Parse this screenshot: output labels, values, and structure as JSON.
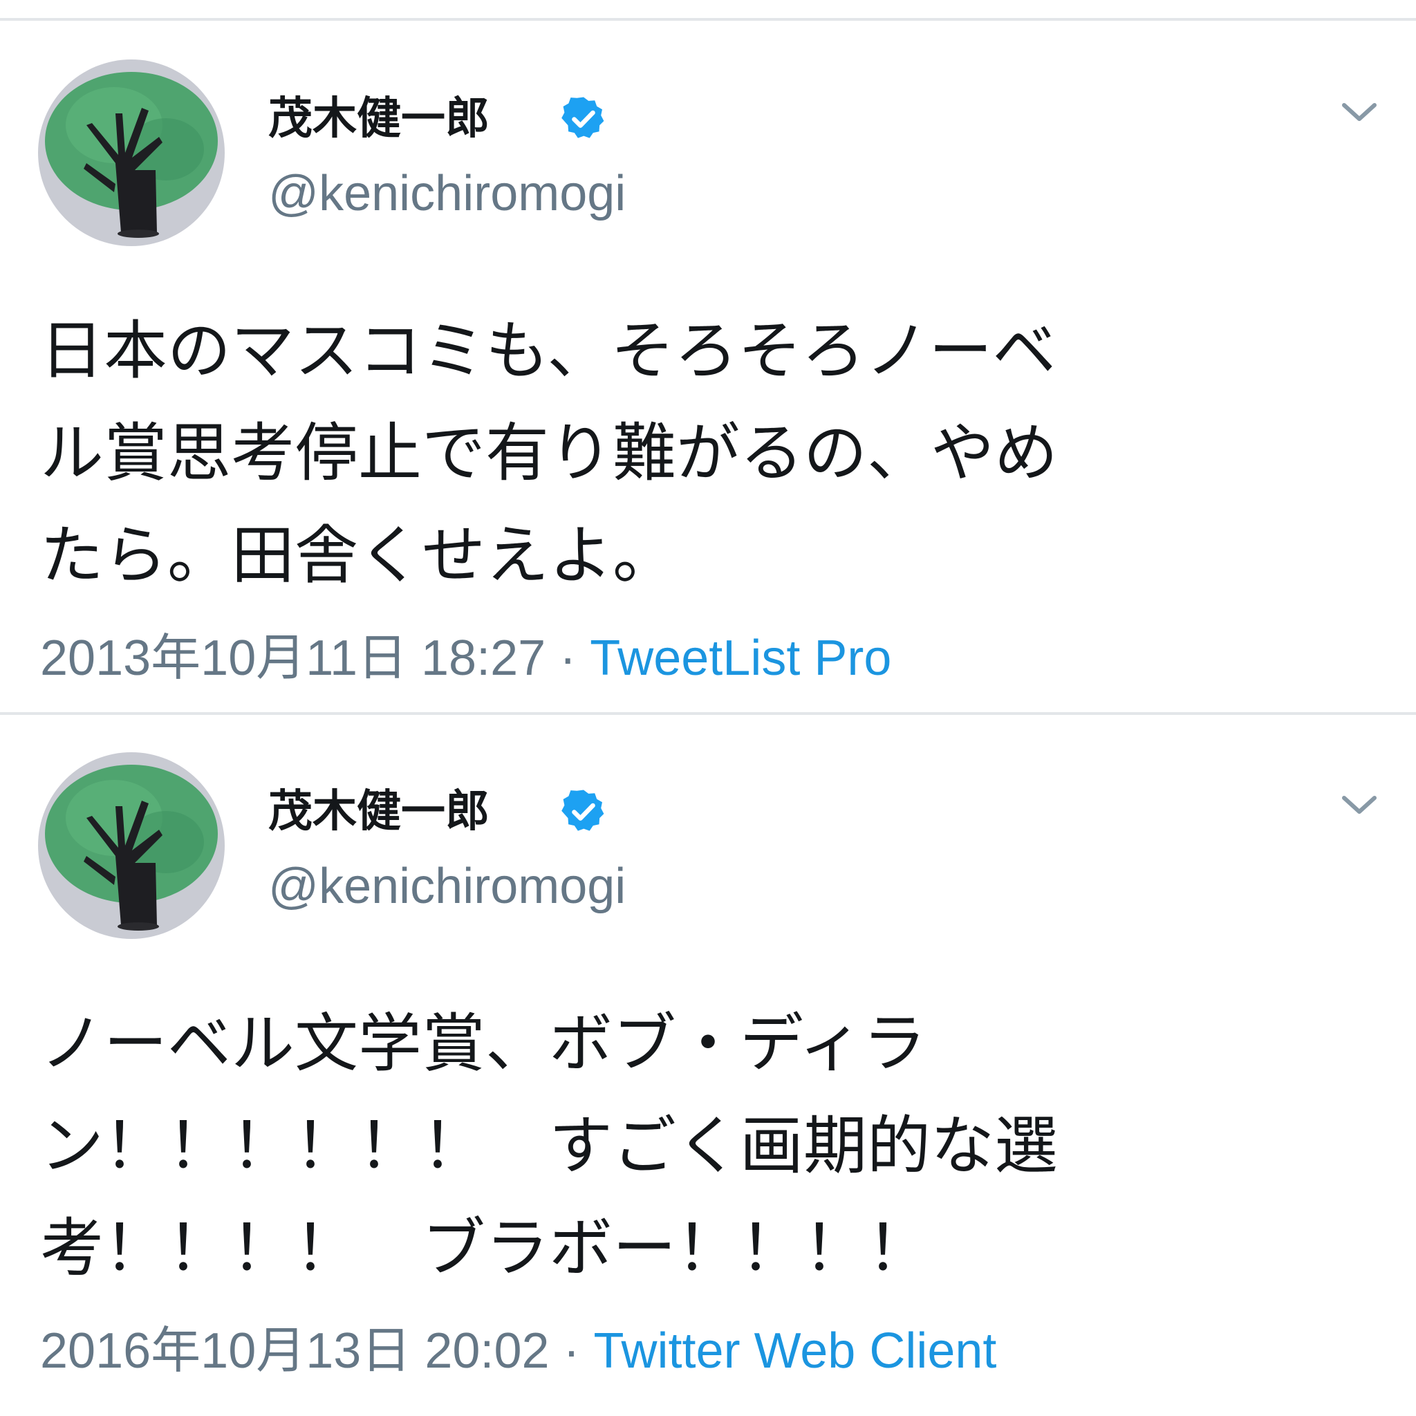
{
  "colors": {
    "accent": "#1b95e0",
    "verified": "#1da1f2",
    "secondary_text": "#657786",
    "divider": "#e3e6e9"
  },
  "tweets": [
    {
      "display_name": "茂木健一郎",
      "handle": "@kenichiromogi",
      "verified_icon": "verified-badge-icon",
      "body_lines": [
        "日本のマスコミも、そろそろノーベ",
        "ル賞思考停止で有り難がるの、やめ",
        "たら。田舎くせえよ。"
      ],
      "timestamp": "2013年10月11日 18:27",
      "separator": "·",
      "client": "TweetList Pro"
    },
    {
      "display_name": "茂木健一郎",
      "handle": "@kenichiromogi",
      "verified_icon": "verified-badge-icon",
      "body_lines": [
        "ノーベル文学賞、ボブ・ディラ",
        "ン！！！！！！　すごく画期的な選",
        "考！！！！　ブラボー！！！！"
      ],
      "timestamp": "2016年10月13日 20:02",
      "separator": "·",
      "client": "Twitter Web Client"
    }
  ]
}
